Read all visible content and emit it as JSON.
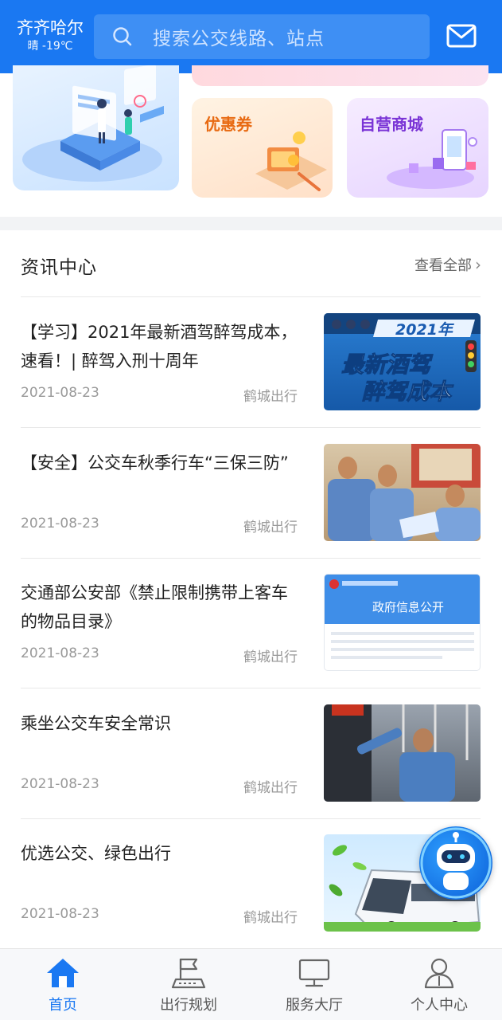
{
  "header": {
    "city": "齐齐哈尔",
    "weather": "晴 -19℃",
    "search_placeholder": "搜索公交线路、站点"
  },
  "promos": {
    "coupon": "优惠券",
    "mall": "自营商城"
  },
  "news": {
    "title": "资讯中心",
    "view_all": "查看全部",
    "items": [
      {
        "title": "【学习】2021年最新酒驾醉驾成本，速看！| 醉驾入刑十周年",
        "date": "2021-08-23",
        "source": "鹤城出行",
        "thumb_text_1": "2021年",
        "thumb_text_2": "最新酒驾",
        "thumb_text_3": "醉驾成本"
      },
      {
        "title": "【安全】公交车秋季行车“三保三防”",
        "date": "2021-08-23",
        "source": "鹤城出行"
      },
      {
        "title": "交通部公安部《禁止限制携带上客车的物品目录》",
        "date": "2021-08-23",
        "source": "鹤城出行",
        "thumb_text_1": "政府信息公开"
      },
      {
        "title": "乘坐公交车安全常识",
        "date": "2021-08-23",
        "source": "鹤城出行"
      },
      {
        "title": "优选公交、绿色出行",
        "date": "2021-08-23",
        "source": "鹤城出行"
      }
    ]
  },
  "tabs": [
    {
      "label": "首页",
      "icon": "home-icon",
      "active": true
    },
    {
      "label": "出行规划",
      "icon": "route-plan-icon",
      "active": false
    },
    {
      "label": "服务大厅",
      "icon": "monitor-icon",
      "active": false
    },
    {
      "label": "个人中心",
      "icon": "user-icon",
      "active": false
    }
  ],
  "colors": {
    "primary": "#1a78f2",
    "coupon": "#e86a12",
    "mall": "#7a34d6"
  }
}
